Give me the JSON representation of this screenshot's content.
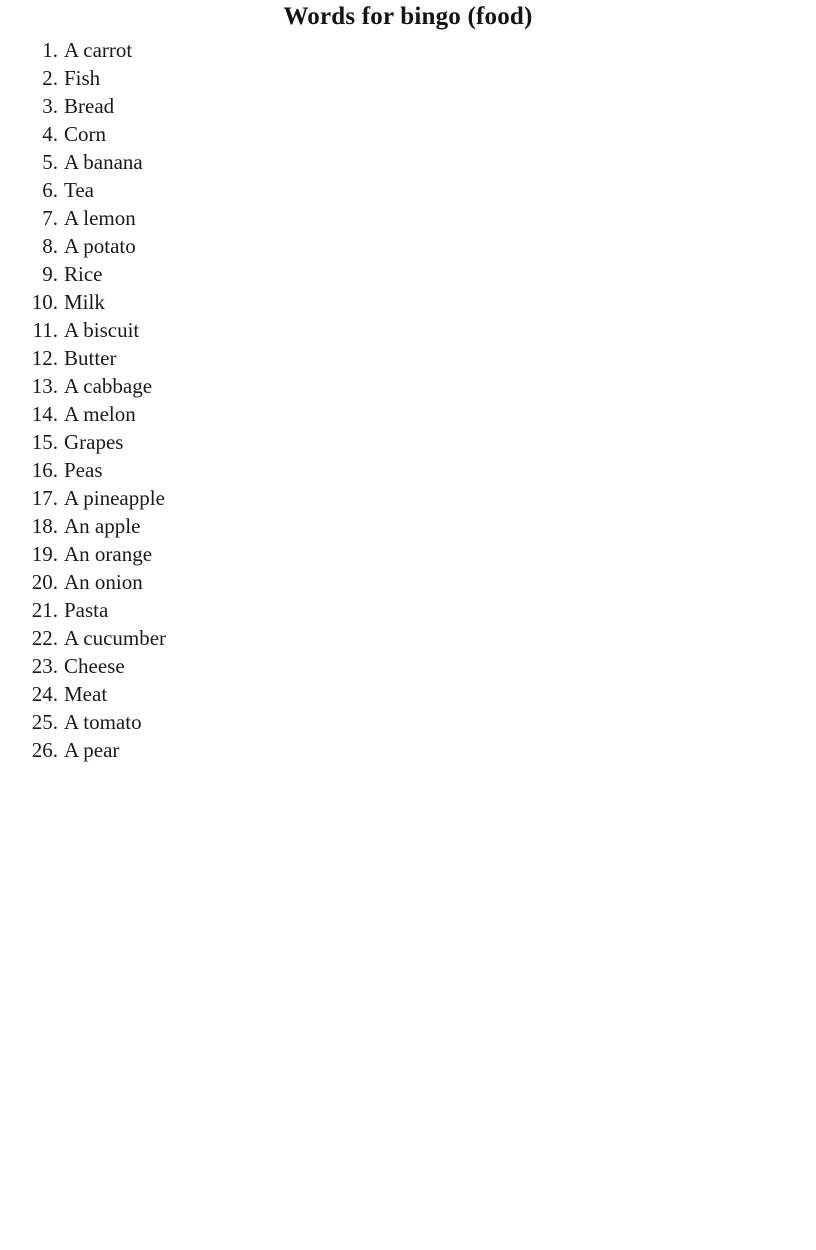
{
  "document": {
    "title": "Words for bingo (food)",
    "list": {
      "items": [
        {
          "number": "1.",
          "label": "A carrot"
        },
        {
          "number": "2.",
          "label": "Fish"
        },
        {
          "number": "3.",
          "label": "Bread"
        },
        {
          "number": "4.",
          "label": "Corn"
        },
        {
          "number": "5.",
          "label": "A banana"
        },
        {
          "number": "6.",
          "label": "Tea"
        },
        {
          "number": "7.",
          "label": "A lemon"
        },
        {
          "number": "8.",
          "label": "A potato"
        },
        {
          "number": "9.",
          "label": "Rice"
        },
        {
          "number": "10.",
          "label": "Milk"
        },
        {
          "number": "11.",
          "label": "A biscuit"
        },
        {
          "number": "12.",
          "label": "Butter"
        },
        {
          "number": "13.",
          "label": "A cabbage"
        },
        {
          "number": "14.",
          "label": "A melon"
        },
        {
          "number": "15.",
          "label": "Grapes"
        },
        {
          "number": "16.",
          "label": "Peas"
        },
        {
          "number": "17.",
          "label": "A pineapple"
        },
        {
          "number": "18.",
          "label": "An apple"
        },
        {
          "number": "19.",
          "label": "An orange"
        },
        {
          "number": "20.",
          "label": "An onion"
        },
        {
          "number": "21.",
          "label": "Pasta"
        },
        {
          "number": "22.",
          "label": "A cucumber"
        },
        {
          "number": "23.",
          "label": "Cheese"
        },
        {
          "number": "24.",
          "label": "Meat"
        },
        {
          "number": "25.",
          "label": "A tomato"
        },
        {
          "number": "26.",
          "label": "A pear"
        }
      ]
    }
  },
  "colors": {
    "page_background": "#ffffff",
    "text": "#1a1a1a"
  }
}
